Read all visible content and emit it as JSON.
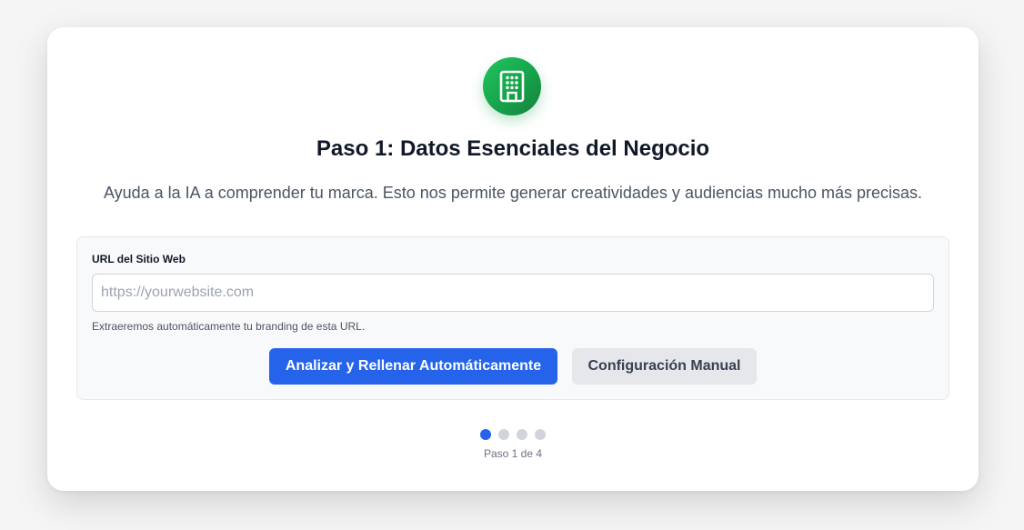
{
  "header": {
    "icon": "building-icon",
    "title": "Paso 1: Datos Esenciales del Negocio",
    "subtitle": "Ayuda a la IA a comprender tu marca. Esto nos permite generar creatividades y audiencias mucho más precisas."
  },
  "form": {
    "url_label": "URL del Sitio Web",
    "url_value": "",
    "url_placeholder": "https://yourwebsite.com",
    "helper_text": "Extraeremos automáticamente tu branding de esta URL.",
    "primary_button": "Analizar y Rellenar Automáticamente",
    "secondary_button": "Configuración Manual"
  },
  "progress": {
    "current_step": 1,
    "total_steps": 4,
    "label": "Paso 1 de 4"
  },
  "colors": {
    "accent": "#2563eb",
    "brand_green": "#16a34a",
    "inactive_dot": "#d1d5db"
  }
}
